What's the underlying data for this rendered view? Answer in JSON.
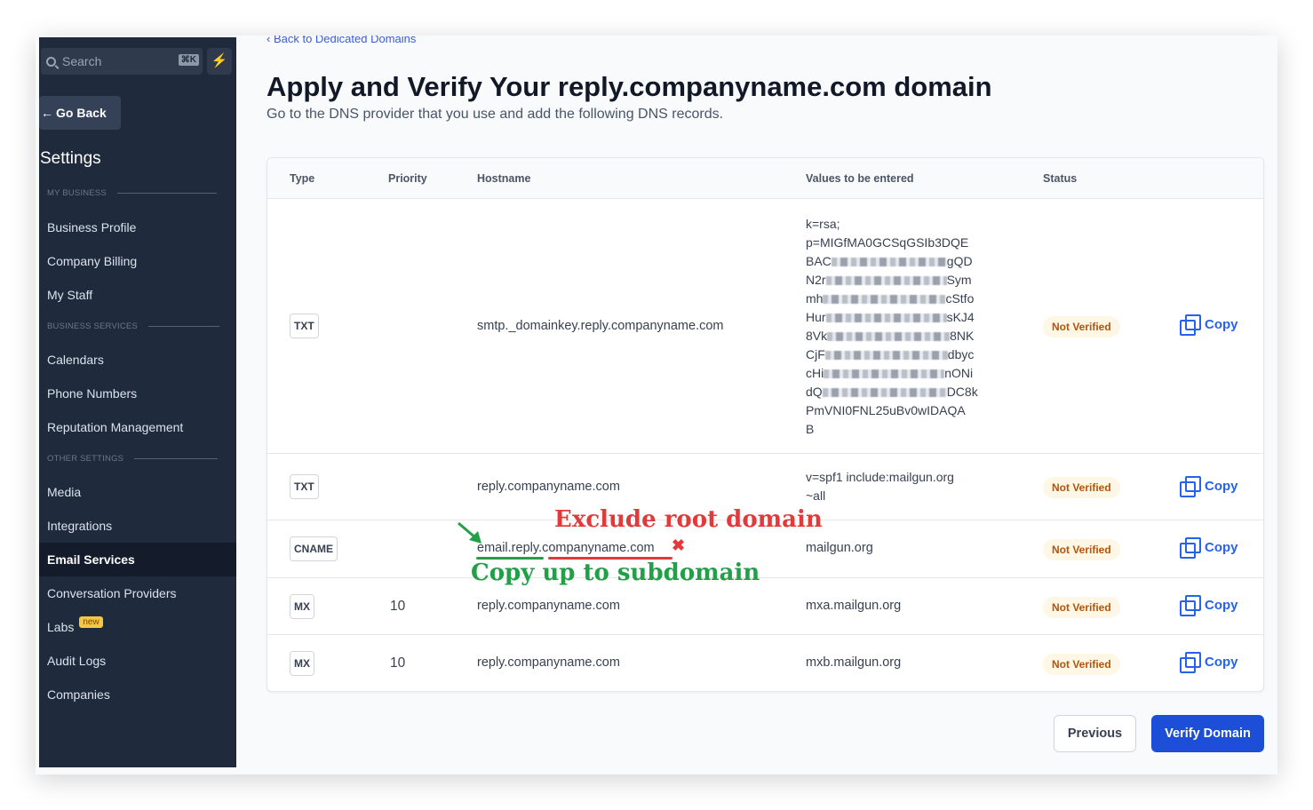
{
  "sidebar": {
    "search_placeholder": "Search",
    "search_shortcut": "⌘K",
    "go_back": "Go Back",
    "settings_title": "Settings",
    "sections": {
      "my_business": "MY BUSINESS",
      "business_services": "BUSINESS SERVICES",
      "other_settings": "OTHER SETTINGS"
    },
    "items": {
      "business_profile": "Business Profile",
      "company_billing": "Company Billing",
      "my_staff": "My Staff",
      "calendars": "Calendars",
      "phone_numbers": "Phone Numbers",
      "reputation": "Reputation Management",
      "media": "Media",
      "integrations": "Integrations",
      "email_services": "Email Services",
      "conversation_providers": "Conversation Providers",
      "labs": "Labs",
      "labs_badge": "new",
      "audit_logs": "Audit Logs",
      "companies": "Companies"
    },
    "active_item": "Email Services"
  },
  "main": {
    "back_link": "Back to Dedicated Domains",
    "title": "Apply and Verify Your reply.companyname.com domain",
    "subtitle": "Go to the DNS provider that you use and add the following DNS records."
  },
  "table": {
    "headers": {
      "type": "Type",
      "priority": "Priority",
      "hostname": "Hostname",
      "values": "Values to be entered",
      "status": "Status"
    },
    "rows": [
      {
        "type": "TXT",
        "priority": "",
        "hostname": "smtp._domainkey.reply.companyname.com",
        "value_lines": [
          "k=rsa;",
          "p=MIGfMA0GCSqGSIb3DQE",
          "BAC",
          "gQD",
          "N2r",
          "Sym",
          "mh",
          "cStfo",
          "Hur",
          "sKJ4",
          "8Vk",
          "8NK",
          "CjF",
          "dbyc",
          "cHi",
          "nONi",
          "dQ",
          "DC8k",
          "PmVNI0FNL25uBv0wIDAQA",
          "B"
        ],
        "status": "Not Verified",
        "copy": "Copy"
      },
      {
        "type": "TXT",
        "priority": "",
        "hostname": "reply.companyname.com",
        "value_lines": [
          "v=spf1 include:mailgun.org",
          "~all"
        ],
        "status": "Not Verified",
        "copy": "Copy"
      },
      {
        "type": "CNAME",
        "priority": "",
        "hostname_parts": [
          "email.reply.",
          "companyname.com"
        ],
        "value": "mailgun.org",
        "status": "Not Verified",
        "copy": "Copy"
      },
      {
        "type": "MX",
        "priority": "10",
        "hostname": "reply.companyname.com",
        "value": "mxa.mailgun.org",
        "status": "Not Verified",
        "copy": "Copy"
      },
      {
        "type": "MX",
        "priority": "10",
        "hostname": "reply.companyname.com",
        "value": "mxb.mailgun.org",
        "status": "Not Verified",
        "copy": "Copy"
      }
    ]
  },
  "annotations": {
    "exclude": "Exclude root domain",
    "copy_up": "Copy up to subdomain",
    "exclude_color": "#e23a3a",
    "copy_color": "#23a047"
  },
  "buttons": {
    "previous": "Previous",
    "verify": "Verify Domain"
  },
  "colors": {
    "sidebar_bg": "#1f2a3c",
    "primary": "#1d4ed8",
    "status_text": "#b45309",
    "status_bg": "#fff7e6"
  }
}
